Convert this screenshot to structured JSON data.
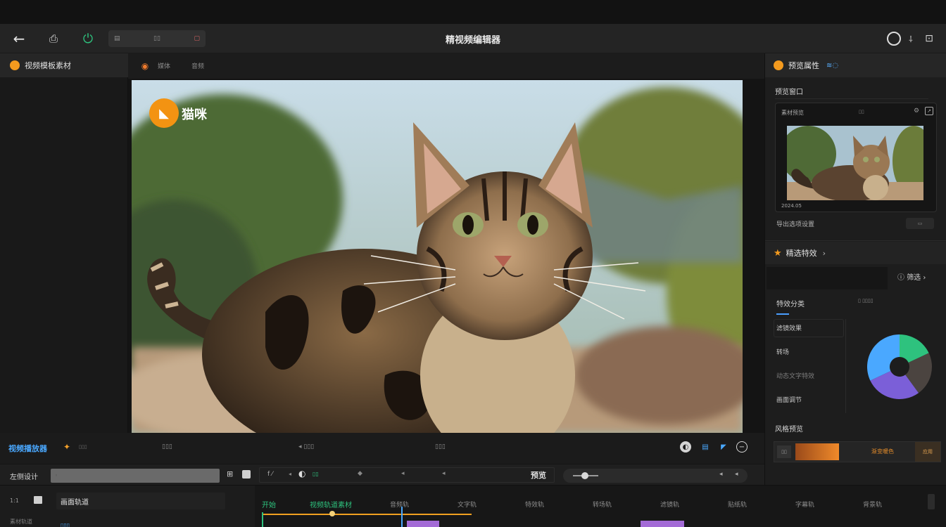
{
  "titlebar": {
    "back_icon": "arrow-left-icon",
    "camera_icon": "camera-icon",
    "plug_icon": "plug-icon",
    "title_field_text": "▤",
    "title_field_mid": "▯▯",
    "title_field_right": "▢",
    "app_title": "精视频编辑器",
    "accent_green": "#2ec27e"
  },
  "left_sidebar": {
    "header": "视频模板素材"
  },
  "center_tabs": {
    "tab1": "媒体",
    "tab2": "音频"
  },
  "viewport": {
    "logo_letter": "◣",
    "logo_text": "猫咪"
  },
  "right_panel": {
    "header": "预览属性",
    "header_accent": "≋◌",
    "section_title": "预览窗口",
    "thumb_title": "素材预览",
    "thumb_mid": "▯▯",
    "thumb_date": "2024.05",
    "caption": "导出选项设置",
    "caption_button": "▭",
    "star_row": "精选特效",
    "filter_label": "筛选",
    "list_head": "特效分类",
    "list_head_right": "▯ ▯▯▯▯",
    "items": [
      "滤镜效果",
      "转场",
      "动态文字特效",
      "画面调节"
    ],
    "bottom_label": "风格预览",
    "bar_btn": "▯▯",
    "bar_mid": "渐变暖色",
    "bar_end": "应用"
  },
  "control_bar": {
    "label": "视频播放器",
    "icon": "film-icon",
    "t1": "▯▯▯",
    "t2": "▯▯▯",
    "t3": "◂ ▯▯▯",
    "t4": "▯▯▯"
  },
  "tool_row": {
    "label": "左侧设计",
    "field": "◦",
    "seg1": "f ⁄",
    "seg2": "◂",
    "seg3": "◐",
    "seg4": "▯▯",
    "seg5": "◆",
    "seg6": "◂",
    "seg7": "◂",
    "mid": "预览",
    "slider_value": 0.4
  },
  "timeline": {
    "layer1": "1:1",
    "layer2": "画面轨道",
    "layer3": "素材轨道",
    "layer4": "▯▯▯",
    "start": "开始",
    "t_labels": [
      "视频轨道素材",
      "音频轨",
      "文字轨",
      "特效轨",
      "转场轨",
      "滤镜轨",
      "贴纸轨",
      "字幕轨",
      "背景轨"
    ]
  },
  "pie": {
    "segments": [
      {
        "color": "#2ec27e",
        "value": 18
      },
      {
        "color": "#4b4440",
        "value": 22
      },
      {
        "color": "#7b5fd8",
        "value": 28
      },
      {
        "color": "#4aa8ff",
        "value": 32
      }
    ]
  }
}
